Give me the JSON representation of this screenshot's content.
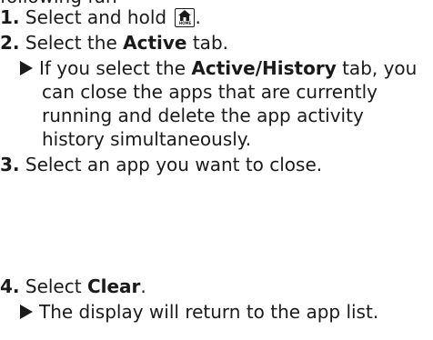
{
  "partial_top": "following fun",
  "steps": [
    {
      "num": "1.",
      "text": "Select and hold",
      "suffix": "."
    },
    {
      "num": "2.",
      "pre": "Select the ",
      "bold": "Active",
      "post": " tab."
    },
    {
      "num": "3.",
      "text": "Select an app you want to close."
    },
    {
      "num": "4.",
      "pre": "Select ",
      "bold": "Clear",
      "post": "."
    }
  ],
  "note_step2": {
    "line1_pre": "If you select the ",
    "line1_bold": "Active/History",
    "line1_post": " tab, you",
    "line2": "can close the apps that are currently",
    "line3": "running and delete the app activity",
    "line4": "history simultaneously."
  },
  "note_step4": "The display will return to the app list.",
  "home_icon_label": "HOME"
}
